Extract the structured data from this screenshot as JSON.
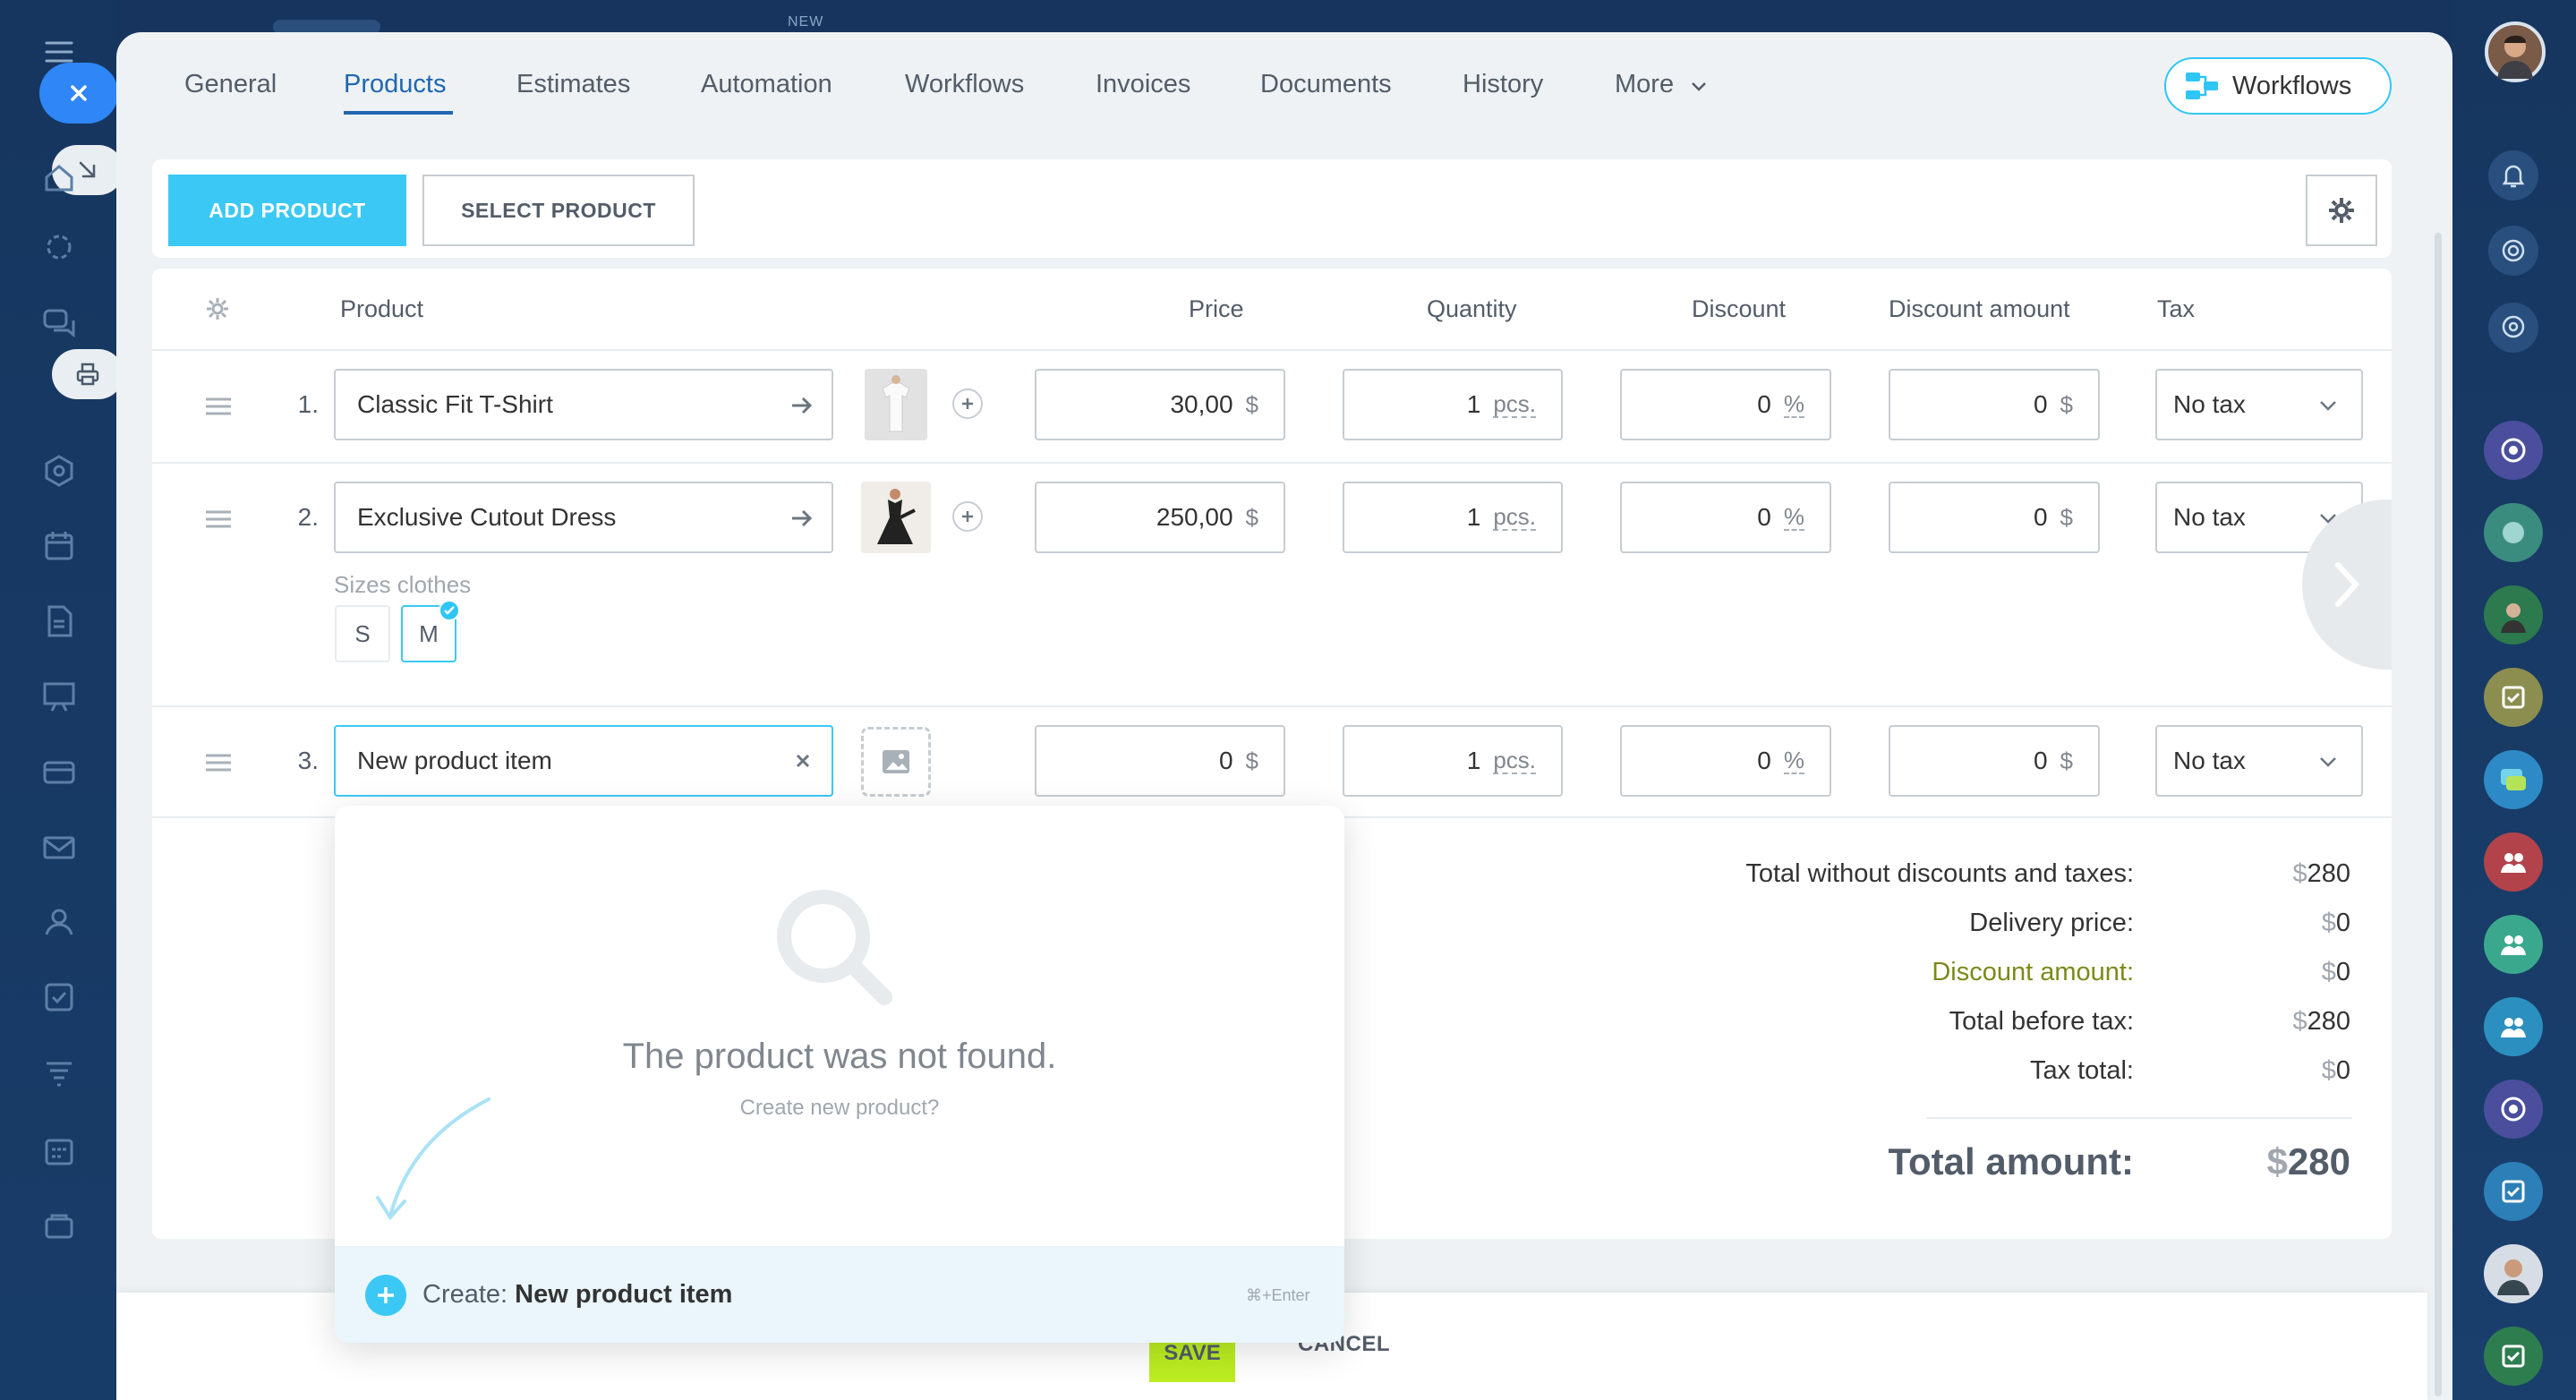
{
  "top_badge": "NEW",
  "tabs": [
    {
      "label": "General"
    },
    {
      "label": "Products"
    },
    {
      "label": "Estimates"
    },
    {
      "label": "Automation"
    },
    {
      "label": "Workflows"
    },
    {
      "label": "Invoices"
    },
    {
      "label": "Documents"
    },
    {
      "label": "History"
    },
    {
      "label": "More"
    }
  ],
  "active_tab": "Products",
  "workflows_button": {
    "label": "Workflows",
    "icon": "workflow-icon"
  },
  "toolbar": {
    "add_label": "ADD PRODUCT",
    "select_label": "SELECT PRODUCT",
    "settings_icon": "gear-icon"
  },
  "columns": {
    "product": "Product",
    "price": "Price",
    "quantity": "Quantity",
    "discount": "Discount",
    "discount_amount": "Discount amount",
    "tax": "Tax"
  },
  "rows": [
    {
      "num": "1.",
      "name": "Classic Fit T-Shirt",
      "price": "30,00",
      "price_unit": "$",
      "qty": "1",
      "qty_unit": "pcs.",
      "discount": "0",
      "discount_unit": "%",
      "discount_amount": "0",
      "discount_amount_unit": "$",
      "tax": "No tax"
    },
    {
      "num": "2.",
      "name": "Exclusive Cutout Dress",
      "price": "250,00",
      "price_unit": "$",
      "qty": "1",
      "qty_unit": "pcs.",
      "discount": "0",
      "discount_unit": "%",
      "discount_amount": "0",
      "discount_amount_unit": "$",
      "tax": "No tax"
    },
    {
      "num": "3.",
      "name": "New product item",
      "price": "0",
      "price_unit": "$",
      "qty": "1",
      "qty_unit": "pcs.",
      "discount": "0",
      "discount_unit": "%",
      "discount_amount": "0",
      "discount_amount_unit": "$",
      "tax": "No tax"
    }
  ],
  "sizes": {
    "label": "Sizes clothes",
    "options": [
      "S",
      "M"
    ],
    "selected": "M"
  },
  "totals": {
    "without_discounts_label": "Total without discounts and taxes:",
    "without_discounts_value": "280",
    "delivery_label": "Delivery price:",
    "delivery_value": "0",
    "discount_label": "Discount amount:",
    "discount_value": "0",
    "before_tax_label": "Total before tax:",
    "before_tax_value": "280",
    "tax_label": "Tax total:",
    "tax_value": "0",
    "grand_label": "Total amount:",
    "grand_value": "280",
    "currency": "$"
  },
  "dropdown": {
    "not_found": "The product was not found.",
    "create_question": "Create new product?",
    "create_prefix": "Create:",
    "create_name": "New product item",
    "shortcut": "⌘+Enter"
  },
  "footer": {
    "save_label": "SAVE",
    "cancel_label": "CANCEL"
  },
  "colors": {
    "accent": "#3bc8f5",
    "link": "#2067b0",
    "save": "#bbed21",
    "discount_label": "#7b8a18",
    "nav_bg": "#16365f"
  }
}
